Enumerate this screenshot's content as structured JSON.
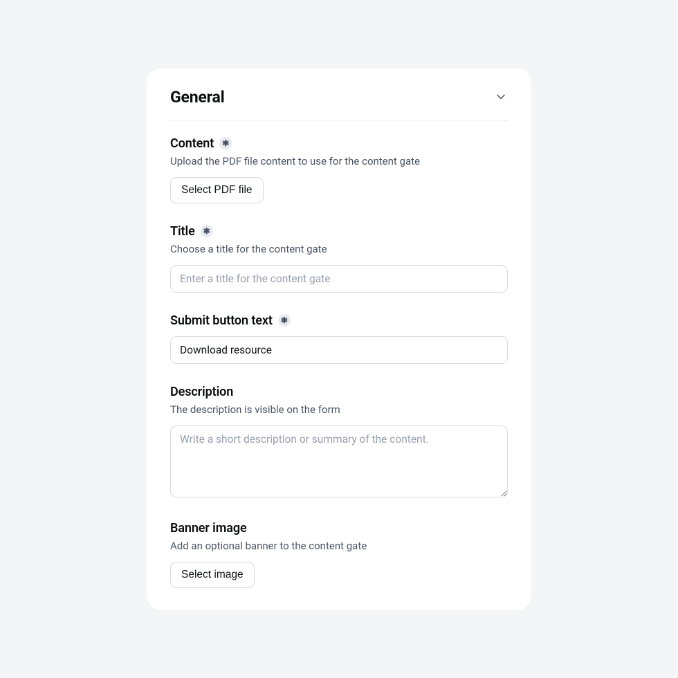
{
  "section": {
    "title": "General"
  },
  "fields": {
    "content": {
      "label": "Content",
      "help": "Upload the PDF file content to use for the content gate",
      "button": "Select PDF file"
    },
    "title": {
      "label": "Title",
      "help": "Choose a title for the content gate",
      "placeholder": "Enter a title for the content gate",
      "value": ""
    },
    "submit": {
      "label": "Submit button text",
      "value": "Download resource"
    },
    "description": {
      "label": "Description",
      "help": "The description is visible on the form",
      "placeholder": "Write a short description or summary of the content.",
      "value": ""
    },
    "banner": {
      "label": "Banner image",
      "help": "Add an optional banner to the content gate",
      "button": "Select image"
    }
  }
}
